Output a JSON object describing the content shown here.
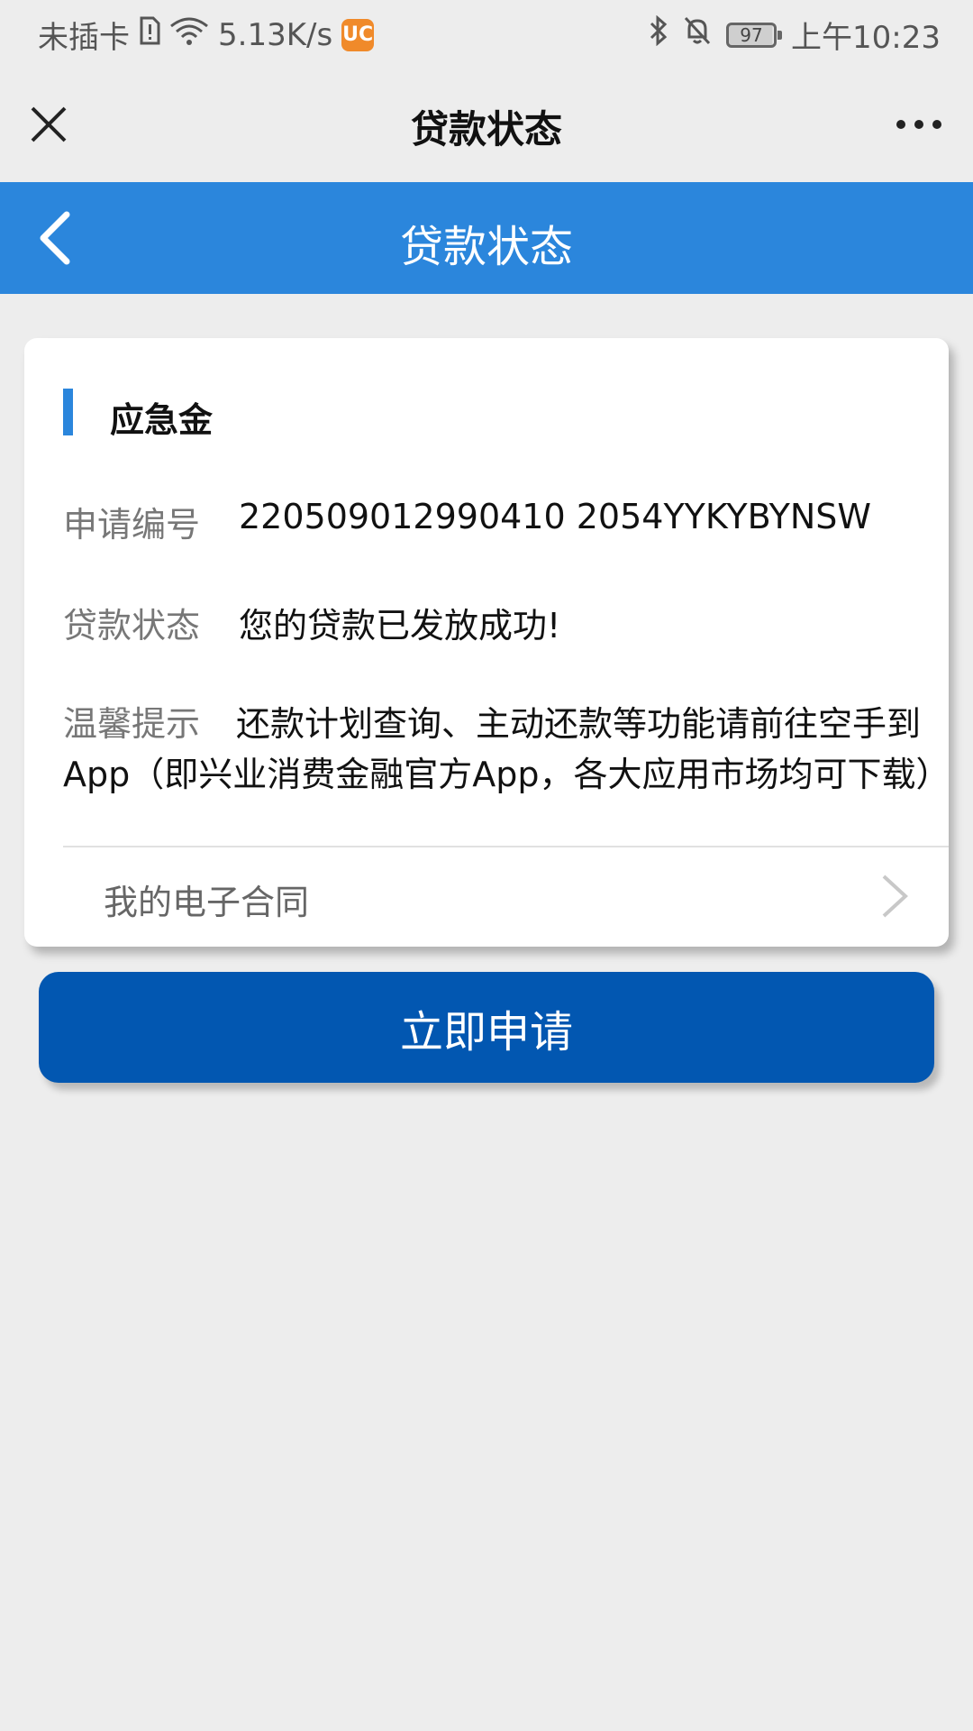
{
  "status_bar": {
    "carrier": "未插卡",
    "network_speed": "5.13K/s",
    "uc_badge": "UC",
    "battery_level": "97",
    "time": "上午10:23",
    "icons": [
      "sim-alert-icon",
      "wifi-icon",
      "uc-browser-icon",
      "bluetooth-icon",
      "bell-off-icon",
      "battery-icon"
    ]
  },
  "header": {
    "title": "贷款状态"
  },
  "subheader": {
    "title": "贷款状态"
  },
  "card": {
    "title": "应急金",
    "rows": [
      {
        "label": "申请编号",
        "value": "220509012990410 2054YYKYBYNSW"
      },
      {
        "label": "贷款状态",
        "value": "您的贷款已发放成功!"
      }
    ],
    "tip_label": "温馨提示",
    "tip_text": "还款计划查询、主动还款等功能请前往空手到App（即兴业消费金融官方App，各大应用市场均可下载）",
    "contract_label": "我的电子合同"
  },
  "apply_button": {
    "label": "立即申请"
  },
  "colors": {
    "accent_blue": "#2b86dc",
    "button_blue": "#0257b1",
    "background": "#ededed"
  }
}
